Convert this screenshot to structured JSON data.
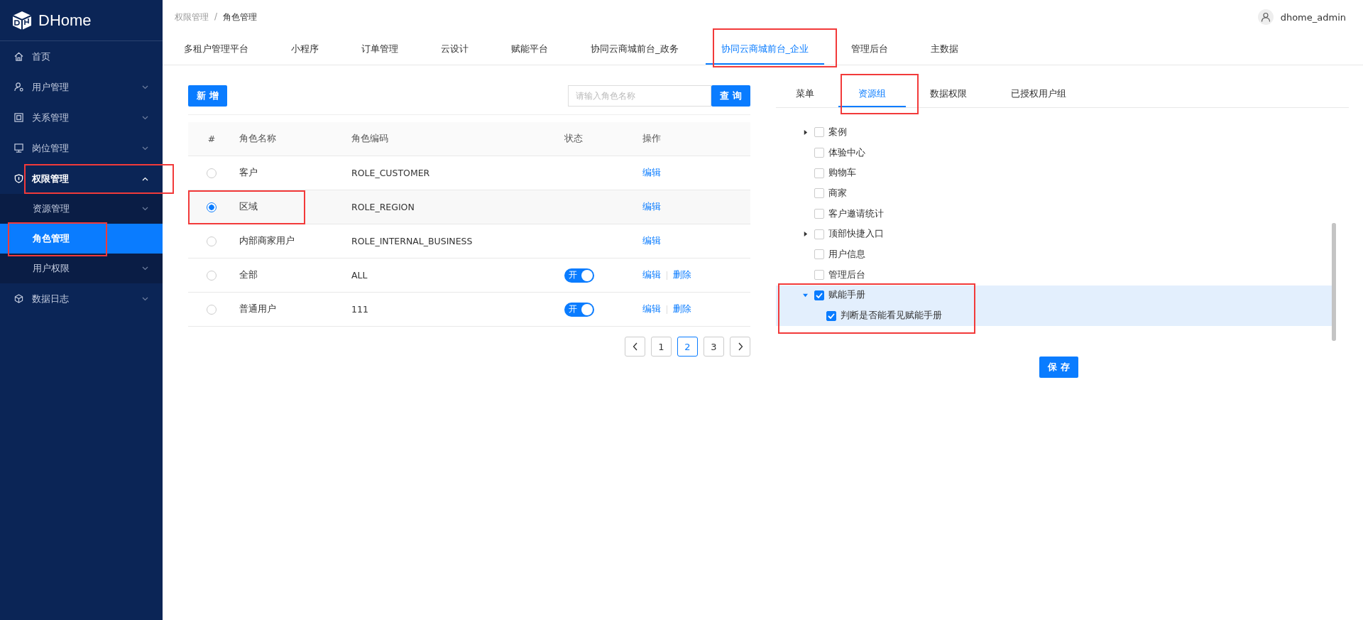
{
  "logo": {
    "text": "DHome"
  },
  "sidebar": {
    "items": [
      {
        "label": "首页",
        "expanded": false,
        "has_arrow": false,
        "annotated": false
      },
      {
        "label": "用户管理",
        "expanded": false,
        "has_arrow": true,
        "annotated": false
      },
      {
        "label": "关系管理",
        "expanded": false,
        "has_arrow": true,
        "annotated": false
      },
      {
        "label": "岗位管理",
        "expanded": false,
        "has_arrow": true,
        "annotated": false
      },
      {
        "label": "权限管理",
        "expanded": true,
        "has_arrow": true,
        "annotated": true,
        "children": [
          {
            "label": "资源管理",
            "selected": false,
            "has_arrow": true,
            "annotated": false
          },
          {
            "label": "角色管理",
            "selected": true,
            "has_arrow": false,
            "annotated": true
          },
          {
            "label": "用户权限",
            "selected": false,
            "has_arrow": true,
            "annotated": false
          }
        ]
      },
      {
        "label": "数据日志",
        "expanded": false,
        "has_arrow": true,
        "annotated": false
      }
    ]
  },
  "breadcrumb": {
    "items": [
      "权限管理",
      "角色管理"
    ],
    "separator": "/"
  },
  "user": {
    "name": "dhome_admin"
  },
  "tabs": [
    {
      "label": "多租户管理平台",
      "selected": false,
      "annotated": false
    },
    {
      "label": "小程序",
      "selected": false,
      "annotated": false
    },
    {
      "label": "订单管理",
      "selected": false,
      "annotated": false
    },
    {
      "label": "云设计",
      "selected": false,
      "annotated": false
    },
    {
      "label": "赋能平台",
      "selected": false,
      "annotated": false
    },
    {
      "label": "协同云商城前台_政务",
      "selected": false,
      "annotated": false
    },
    {
      "label": "协同云商城前台_企业",
      "selected": true,
      "annotated": true
    },
    {
      "label": "管理后台",
      "selected": false,
      "annotated": false
    },
    {
      "label": "主数据",
      "selected": false,
      "annotated": false
    }
  ],
  "toolbar": {
    "add_button": "新 增",
    "search": {
      "placeholder": "请输入角色名称"
    },
    "search_button": "查 询"
  },
  "table": {
    "columns": [
      "#",
      "角色名称",
      "角色编码",
      "状态",
      "操作"
    ],
    "rows": [
      {
        "selected": false,
        "annotated": false,
        "name": "客户",
        "code": "ROLE_CUSTOMER",
        "actions": [
          "编辑"
        ]
      },
      {
        "selected": true,
        "annotated": true,
        "name": "区域",
        "code": "ROLE_REGION",
        "actions": [
          "编辑"
        ]
      },
      {
        "selected": false,
        "annotated": false,
        "name": "内部商家用户",
        "code": "ROLE_INTERNAL_BUSINESS",
        "actions": [
          "编辑"
        ]
      },
      {
        "selected": false,
        "annotated": false,
        "name": "全部",
        "code": "ALL",
        "switch": {
          "label": "开",
          "on": true
        },
        "actions": [
          "编辑",
          "删除"
        ]
      },
      {
        "selected": false,
        "annotated": false,
        "name": "普通用户",
        "code": "111",
        "switch": {
          "label": "开",
          "on": true
        },
        "actions": [
          "编辑",
          "删除"
        ]
      }
    ]
  },
  "pagination": {
    "pages": [
      {
        "label": "1",
        "selected": false
      },
      {
        "label": "2",
        "selected": true
      },
      {
        "label": "3",
        "selected": false
      }
    ]
  },
  "right_tabs": [
    {
      "label": "菜单",
      "selected": false,
      "annotated": false
    },
    {
      "label": "资源组",
      "selected": true,
      "annotated": true
    },
    {
      "label": "数据权限",
      "selected": false,
      "annotated": false
    },
    {
      "label": "已授权用户组",
      "selected": false,
      "annotated": false
    }
  ],
  "tree": [
    {
      "label": "案例",
      "checked": false,
      "expanded": false,
      "highlighted": false,
      "annotated": false
    },
    {
      "label": "体验中心",
      "checked": false,
      "highlighted": false,
      "annotated": false
    },
    {
      "label": "购物车",
      "checked": false,
      "highlighted": false,
      "annotated": false
    },
    {
      "label": "商家",
      "checked": false,
      "highlighted": false,
      "annotated": false
    },
    {
      "label": "客户邀请统计",
      "checked": false,
      "highlighted": false,
      "annotated": false
    },
    {
      "label": "顶部快捷入口",
      "checked": false,
      "expanded": false,
      "highlighted": false,
      "annotated": false
    },
    {
      "label": "用户信息",
      "checked": false,
      "highlighted": false,
      "annotated": false
    },
    {
      "label": "管理后台",
      "checked": false,
      "highlighted": false,
      "annotated": false
    },
    {
      "label": "赋能手册",
      "checked": true,
      "expanded": true,
      "highlighted": true,
      "annotated": true,
      "children": [
        {
          "label": "判断是否能看见赋能手册",
          "checked": true,
          "highlighted": true
        }
      ]
    }
  ],
  "save_button": "保 存"
}
